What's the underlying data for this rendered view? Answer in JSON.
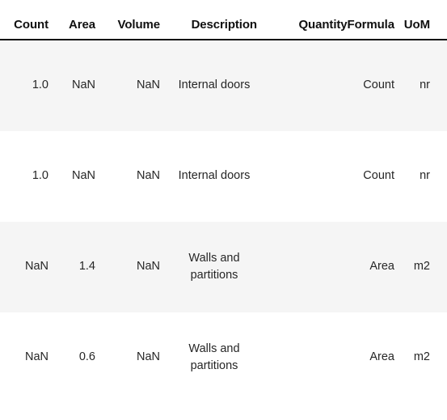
{
  "table": {
    "columns": [
      {
        "key": "count",
        "label": "Count",
        "align": "right"
      },
      {
        "key": "area",
        "label": "Area",
        "align": "right"
      },
      {
        "key": "volume",
        "label": "Volume",
        "align": "right"
      },
      {
        "key": "description",
        "label": "Description",
        "align": "center"
      },
      {
        "key": "quantityformula",
        "label": "QuantityFormula",
        "align": "right"
      },
      {
        "key": "uom",
        "label": "UoM",
        "align": "right"
      }
    ],
    "rows": [
      {
        "count": "1.0",
        "area": "NaN",
        "volume": "NaN",
        "description": "Internal doors",
        "quantityformula": "Count",
        "uom": "nr",
        "stripe": "odd"
      },
      {
        "count": "1.0",
        "area": "NaN",
        "volume": "NaN",
        "description": "Internal doors",
        "quantityformula": "Count",
        "uom": "nr",
        "stripe": "even"
      },
      {
        "count": "NaN",
        "area": "1.4",
        "volume": "NaN",
        "description": "Walls and partitions",
        "quantityformula": "Area",
        "uom": "m2",
        "stripe": "odd"
      },
      {
        "count": "NaN",
        "area": "0.6",
        "volume": "NaN",
        "description": "Walls and partitions",
        "quantityformula": "Area",
        "uom": "m2",
        "stripe": "even"
      }
    ]
  },
  "style": {
    "stripe_color": "#f5f5f5",
    "base_color": "#ffffff",
    "header_rule_color": "#111111",
    "header_text_color": "#101010",
    "body_text_color": "#262626"
  }
}
